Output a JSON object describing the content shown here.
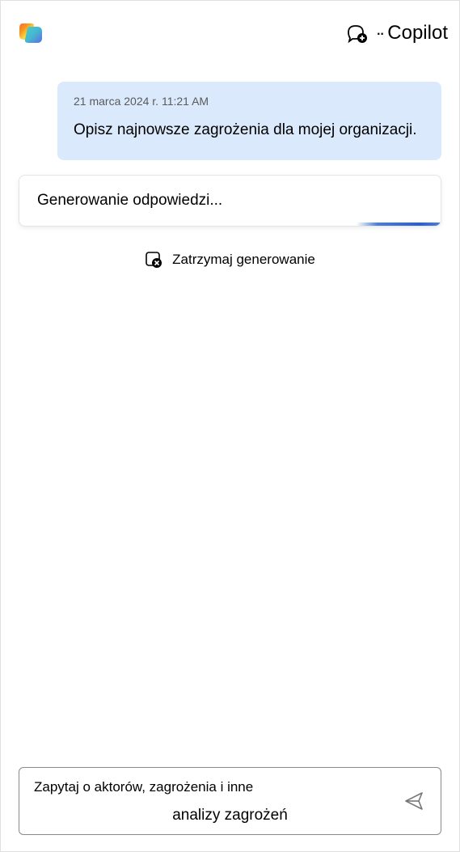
{
  "header": {
    "brand": "Copilot"
  },
  "conversation": {
    "user_message": {
      "timestamp": "21 marca 2024 r. 11:21   AM",
      "text": "Opisz najnowsze zagrożenia dla mojej organizacji."
    },
    "response": {
      "status_text": "Generowanie odpowiedzi..."
    },
    "stop_action": {
      "label": "Zatrzymaj generowanie"
    }
  },
  "input": {
    "placeholder": "Zapytaj o aktorów, zagrożenia i inne",
    "subtitle": "analizy zagrożeń"
  }
}
